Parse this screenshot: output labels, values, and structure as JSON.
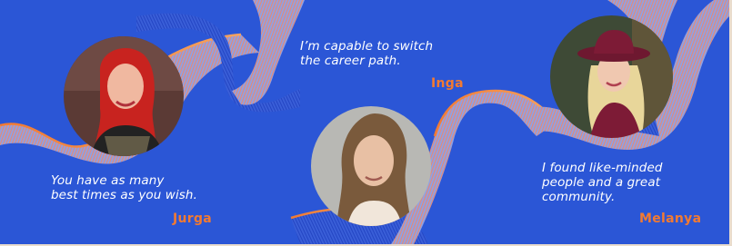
{
  "testimonials": [
    {
      "name": "Jurga",
      "quote_line1": "You have as many",
      "quote_line2": "best times as you wish.",
      "avatar": "portrait-woman-red-hair"
    },
    {
      "name": "Inga",
      "quote_line1": "I’m capable to switch",
      "quote_line2": "the career path.",
      "avatar": "portrait-woman-brown-hair"
    },
    {
      "name": "Melanya",
      "quote_line1": "I found like-minded",
      "quote_line2": "people and a great",
      "quote_line3": "community.",
      "avatar": "portrait-woman-burgundy-hat"
    }
  ],
  "colors": {
    "background": "#2b56d6",
    "accent": "#f27a32",
    "ribbon_light": "#9fb0e6",
    "ribbon_dark": "#1d3fb8",
    "text": "#ffffff"
  }
}
